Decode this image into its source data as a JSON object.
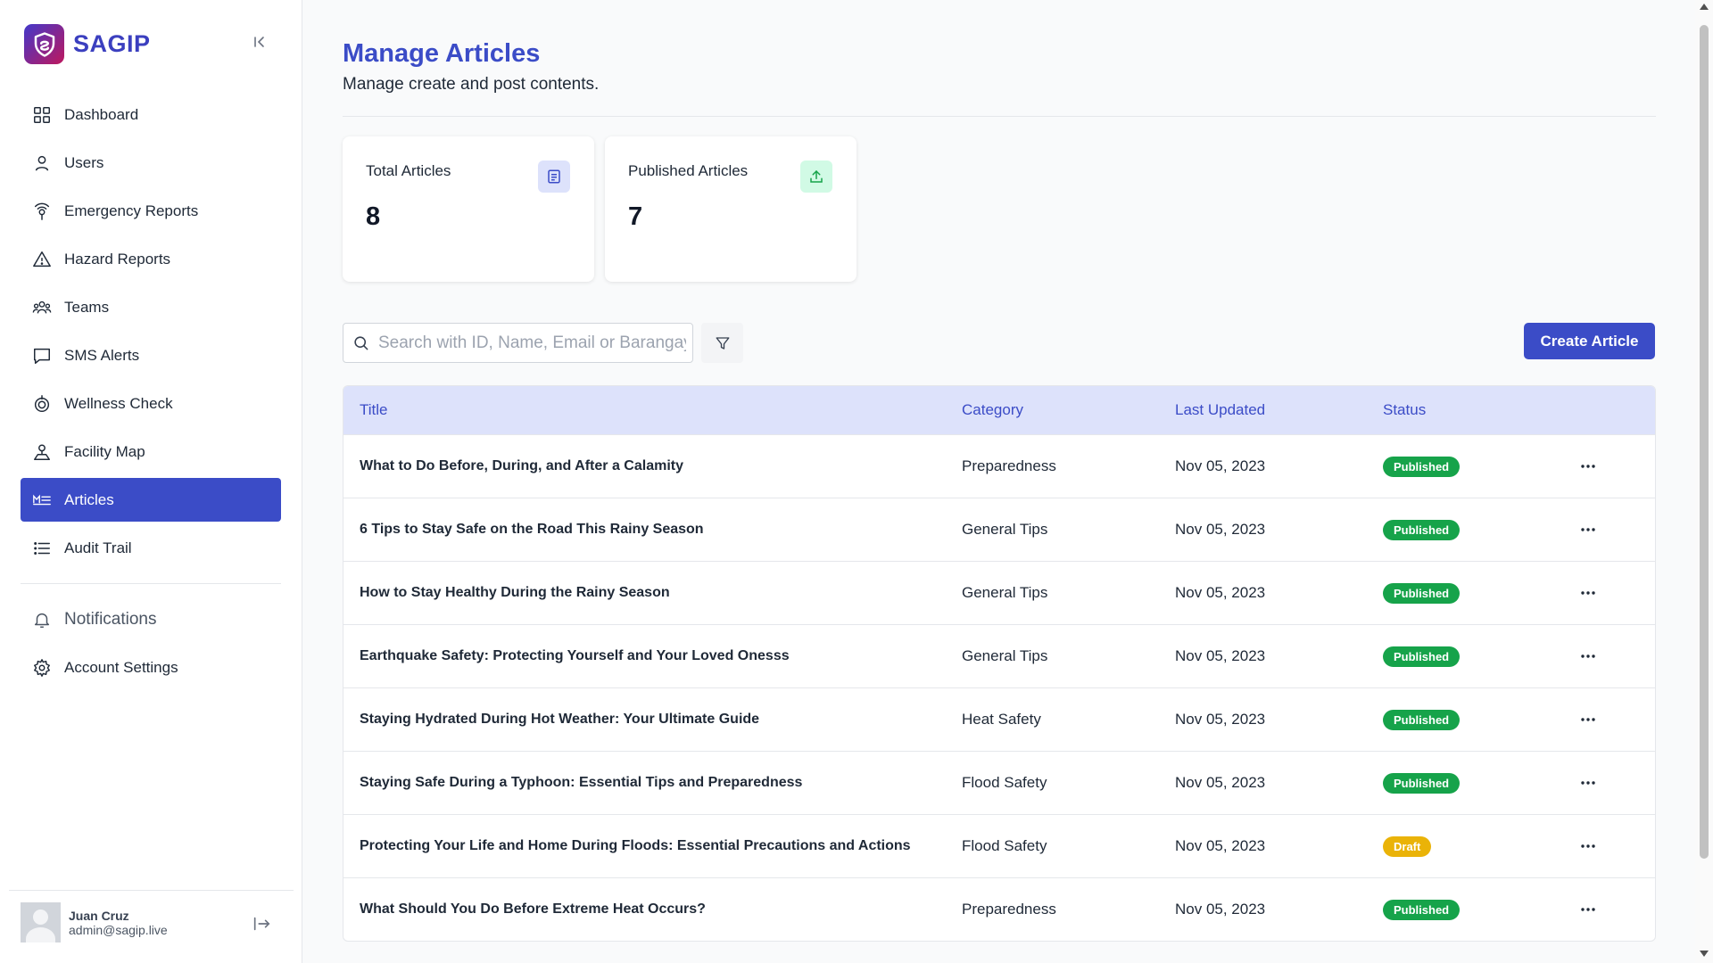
{
  "brand": {
    "name": "SAGIP"
  },
  "sidebar": {
    "items": [
      {
        "label": "Dashboard",
        "icon": "dashboard-icon"
      },
      {
        "label": "Users",
        "icon": "user-icon"
      },
      {
        "label": "Emergency Reports",
        "icon": "emergency-icon"
      },
      {
        "label": "Hazard Reports",
        "icon": "warning-icon"
      },
      {
        "label": "Teams",
        "icon": "teams-icon"
      },
      {
        "label": "SMS Alerts",
        "icon": "message-icon"
      },
      {
        "label": "Wellness Check",
        "icon": "wellness-icon"
      },
      {
        "label": "Facility Map",
        "icon": "map-pin-icon"
      },
      {
        "label": "Articles",
        "icon": "articles-icon",
        "active": true
      },
      {
        "label": "Audit Trail",
        "icon": "list-icon"
      }
    ],
    "secondary": [
      {
        "label": "Notifications",
        "icon": "bell-icon"
      },
      {
        "label": "Account Settings",
        "icon": "gear-icon"
      }
    ]
  },
  "user": {
    "name": "Juan Cruz",
    "email": "admin@sagip.live"
  },
  "header": {
    "title": "Manage Articles",
    "subtitle": "Manage create and post contents."
  },
  "stats": {
    "total": {
      "label": "Total Articles",
      "value": "8",
      "icon_color": "#dde2fb"
    },
    "published": {
      "label": "Published Articles",
      "value": "7",
      "icon_color": "#d1fae5"
    }
  },
  "search": {
    "placeholder": "Search with ID, Name, Email or Barangay"
  },
  "toolbar": {
    "create_label": "Create Article"
  },
  "table": {
    "columns": [
      "Title",
      "Category",
      "Last Updated",
      "Status"
    ],
    "rows": [
      {
        "title": "What to Do Before, During, and After a Calamity",
        "category": "Preparedness",
        "updated": "Nov 05, 2023",
        "status": "Published"
      },
      {
        "title": "6 Tips to Stay Safe on the Road This Rainy Season",
        "category": "General Tips",
        "updated": "Nov 05, 2023",
        "status": "Published"
      },
      {
        "title": "How to Stay Healthy During the Rainy Season",
        "category": "General Tips",
        "updated": "Nov 05, 2023",
        "status": "Published"
      },
      {
        "title": "Earthquake Safety: Protecting Yourself and Your Loved Onesss",
        "category": "General Tips",
        "updated": "Nov 05, 2023",
        "status": "Published"
      },
      {
        "title": "Staying Hydrated During Hot Weather: Your Ultimate Guide",
        "category": "Heat Safety",
        "updated": "Nov 05, 2023",
        "status": "Published"
      },
      {
        "title": "Staying Safe During a Typhoon: Essential Tips and Preparedness",
        "category": "Flood Safety",
        "updated": "Nov 05, 2023",
        "status": "Published"
      },
      {
        "title": "Protecting Your Life and Home During Floods: Essential Precautions and Actions",
        "category": "Flood Safety",
        "updated": "Nov 05, 2023",
        "status": "Draft"
      },
      {
        "title": "What Should You Do Before Extreme Heat Occurs?",
        "category": "Preparedness",
        "updated": "Nov 05, 2023",
        "status": "Published"
      }
    ]
  },
  "colors": {
    "accent": "#3b4cc7",
    "published": "#16a34a",
    "draft": "#eab308",
    "table_header_bg": "#dde2fb"
  }
}
